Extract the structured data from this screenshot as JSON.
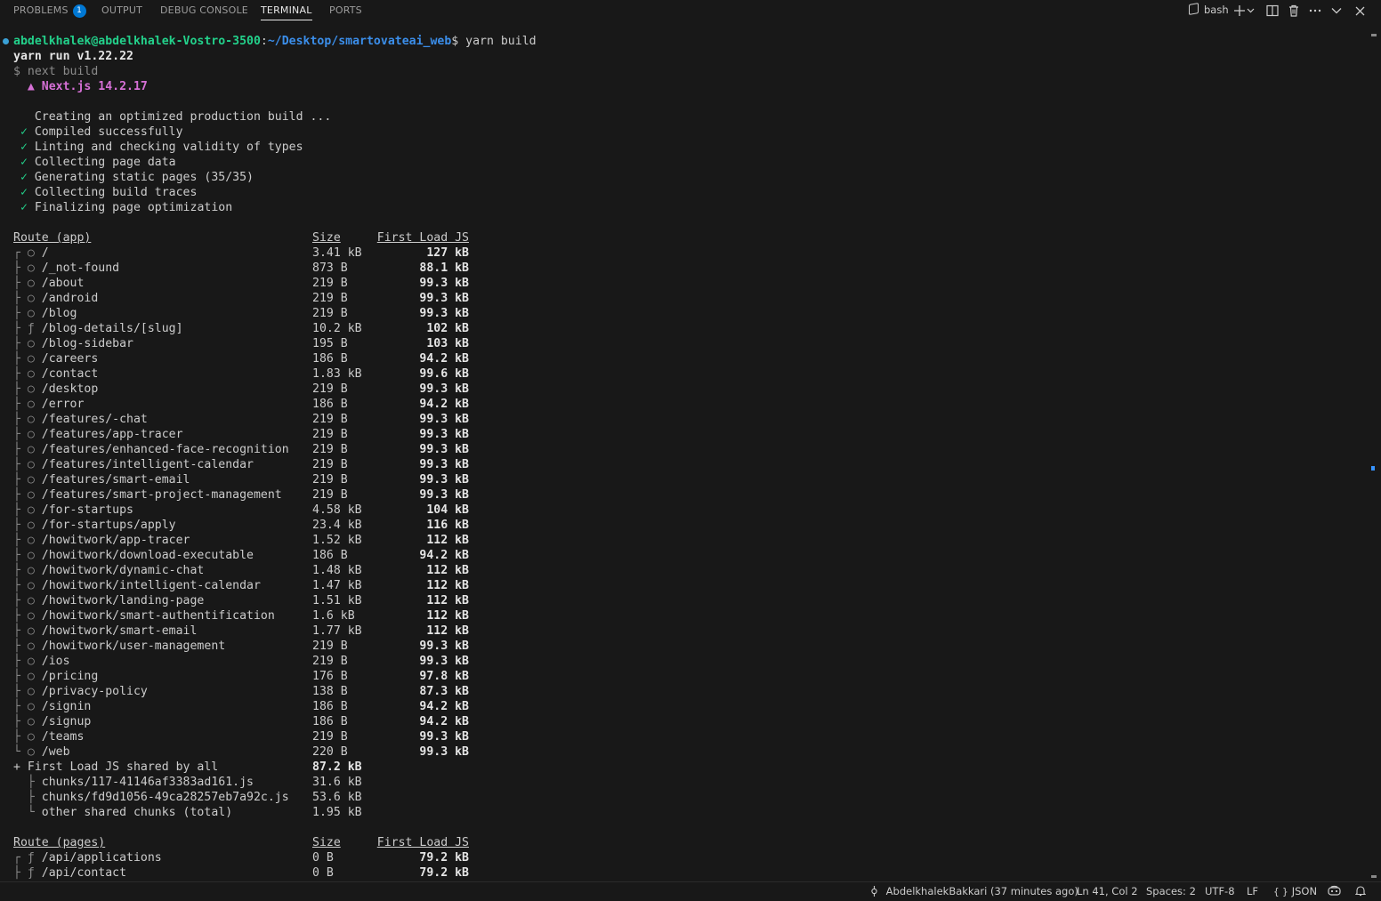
{
  "panel": {
    "tabs": [
      {
        "label": "Problems",
        "badge": "1"
      },
      {
        "label": "Output"
      },
      {
        "label": "Debug Console"
      },
      {
        "label": "Terminal"
      },
      {
        "label": "Ports"
      }
    ],
    "shell": "bash",
    "icons": [
      "plus-icon",
      "chevron-down-icon",
      "split-icon",
      "trash-icon",
      "more-icon",
      "chevron-down-icon",
      "close-icon"
    ]
  },
  "terminal": {
    "prompt_user": "abdelkhalek@abdelkhalek-Vostro-3500",
    "prompt_sep": ":",
    "prompt_path": "~/Desktop/smartovateai_web",
    "prompt_end": "$ ",
    "command": "yarn build",
    "yarn_version": "yarn run v1.22.22",
    "next_cmd": "$ next build",
    "next_version": "  ▲ Next.js 14.2.17",
    "creating": "   Creating an optimized production build ...",
    "steps": [
      "Compiled successfully",
      "Linting and checking validity of types",
      "Collecting page data",
      "Generating static pages (35/35)",
      "Collecting build traces",
      "Finalizing page optimization"
    ],
    "check_mark": " ✓ ",
    "app_table": {
      "header_route": "Route (app)",
      "header_size": "Size",
      "header_load": "First Load JS",
      "rows": [
        {
          "prefix": "┌ ○ ",
          "route": "/",
          "size": "3.41 kB",
          "load": "127 kB"
        },
        {
          "prefix": "├ ○ ",
          "route": "/_not-found",
          "size": "873 B",
          "load": "88.1 kB"
        },
        {
          "prefix": "├ ○ ",
          "route": "/about",
          "size": "219 B",
          "load": "99.3 kB"
        },
        {
          "prefix": "├ ○ ",
          "route": "/android",
          "size": "219 B",
          "load": "99.3 kB"
        },
        {
          "prefix": "├ ○ ",
          "route": "/blog",
          "size": "219 B",
          "load": "99.3 kB"
        },
        {
          "prefix": "├ ƒ ",
          "route": "/blog-details/[slug]",
          "size": "10.2 kB",
          "load": "102 kB"
        },
        {
          "prefix": "├ ○ ",
          "route": "/blog-sidebar",
          "size": "195 B",
          "load": "103 kB"
        },
        {
          "prefix": "├ ○ ",
          "route": "/careers",
          "size": "186 B",
          "load": "94.2 kB"
        },
        {
          "prefix": "├ ○ ",
          "route": "/contact",
          "size": "1.83 kB",
          "load": "99.6 kB"
        },
        {
          "prefix": "├ ○ ",
          "route": "/desktop",
          "size": "219 B",
          "load": "99.3 kB"
        },
        {
          "prefix": "├ ○ ",
          "route": "/error",
          "size": "186 B",
          "load": "94.2 kB"
        },
        {
          "prefix": "├ ○ ",
          "route": "/features/-chat",
          "size": "219 B",
          "load": "99.3 kB"
        },
        {
          "prefix": "├ ○ ",
          "route": "/features/app-tracer",
          "size": "219 B",
          "load": "99.3 kB"
        },
        {
          "prefix": "├ ○ ",
          "route": "/features/enhanced-face-recognition",
          "size": "219 B",
          "load": "99.3 kB"
        },
        {
          "prefix": "├ ○ ",
          "route": "/features/intelligent-calendar",
          "size": "219 B",
          "load": "99.3 kB"
        },
        {
          "prefix": "├ ○ ",
          "route": "/features/smart-email",
          "size": "219 B",
          "load": "99.3 kB"
        },
        {
          "prefix": "├ ○ ",
          "route": "/features/smart-project-management",
          "size": "219 B",
          "load": "99.3 kB"
        },
        {
          "prefix": "├ ○ ",
          "route": "/for-startups",
          "size": "4.58 kB",
          "load": "104 kB"
        },
        {
          "prefix": "├ ○ ",
          "route": "/for-startups/apply",
          "size": "23.4 kB",
          "load": "116 kB"
        },
        {
          "prefix": "├ ○ ",
          "route": "/howitwork/app-tracer",
          "size": "1.52 kB",
          "load": "112 kB"
        },
        {
          "prefix": "├ ○ ",
          "route": "/howitwork/download-executable",
          "size": "186 B",
          "load": "94.2 kB"
        },
        {
          "prefix": "├ ○ ",
          "route": "/howitwork/dynamic-chat",
          "size": "1.48 kB",
          "load": "112 kB"
        },
        {
          "prefix": "├ ○ ",
          "route": "/howitwork/intelligent-calendar",
          "size": "1.47 kB",
          "load": "112 kB"
        },
        {
          "prefix": "├ ○ ",
          "route": "/howitwork/landing-page",
          "size": "1.51 kB",
          "load": "112 kB"
        },
        {
          "prefix": "├ ○ ",
          "route": "/howitwork/smart-authentification",
          "size": "1.6 kB",
          "load": "112 kB"
        },
        {
          "prefix": "├ ○ ",
          "route": "/howitwork/smart-email",
          "size": "1.77 kB",
          "load": "112 kB"
        },
        {
          "prefix": "├ ○ ",
          "route": "/howitwork/user-management",
          "size": "219 B",
          "load": "99.3 kB"
        },
        {
          "prefix": "├ ○ ",
          "route": "/ios",
          "size": "219 B",
          "load": "99.3 kB"
        },
        {
          "prefix": "├ ○ ",
          "route": "/pricing",
          "size": "176 B",
          "load": "97.8 kB"
        },
        {
          "prefix": "├ ○ ",
          "route": "/privacy-policy",
          "size": "138 B",
          "load": "87.3 kB"
        },
        {
          "prefix": "├ ○ ",
          "route": "/signin",
          "size": "186 B",
          "load": "94.2 kB"
        },
        {
          "prefix": "├ ○ ",
          "route": "/signup",
          "size": "186 B",
          "load": "94.2 kB"
        },
        {
          "prefix": "├ ○ ",
          "route": "/teams",
          "size": "219 B",
          "load": "99.3 kB"
        },
        {
          "prefix": "└ ○ ",
          "route": "/web",
          "size": "220 B",
          "load": "99.3 kB"
        }
      ],
      "shared_label": "+ First Load JS shared by all",
      "shared_size": "87.2 kB",
      "shared_rows": [
        {
          "prefix": "  ├ ",
          "name": "chunks/117-41146af3383ad161.js",
          "size": "31.6 kB"
        },
        {
          "prefix": "  ├ ",
          "name": "chunks/fd9d1056-49ca28257eb7a92c.js",
          "size": "53.6 kB"
        },
        {
          "prefix": "  └ ",
          "name": "other shared chunks (total)",
          "size": "1.95 kB"
        }
      ]
    },
    "pages_table": {
      "header_route": "Route (pages)",
      "header_size": "Size",
      "header_load": "First Load JS",
      "rows": [
        {
          "prefix": "┌ ƒ ",
          "route": "/api/applications",
          "size": "0 B",
          "load": "79.2 kB"
        },
        {
          "prefix": "├ ƒ ",
          "route": "/api/contact",
          "size": "0 B",
          "load": "79.2 kB"
        }
      ]
    }
  },
  "status_bar": {
    "blame": "AbdelkhalekBakkari (37 minutes ago)",
    "cursor": "Ln 41, Col 2",
    "spaces": "Spaces: 2",
    "encoding": "UTF-8",
    "eol": "LF",
    "language_icon": "{ }",
    "language": "JSON"
  }
}
